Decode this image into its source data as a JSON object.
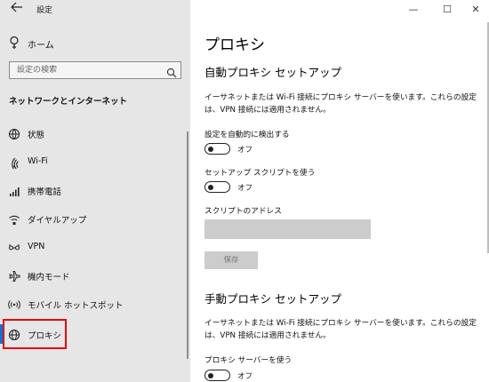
{
  "window": {
    "app_title": "設定",
    "controls": {
      "minimize": "—",
      "maximize": "☐",
      "close": "✕"
    }
  },
  "sidebar": {
    "back_icon": "back-arrow-icon",
    "home": {
      "label": "ホーム",
      "icon": "home-icon"
    },
    "search": {
      "placeholder": "設定の検索",
      "icon": "search-icon"
    },
    "section_heading": "ネットワークとインターネット",
    "items": [
      {
        "label": "状態",
        "icon": "globe-status-icon"
      },
      {
        "label": "Wi-Fi",
        "icon": "wifi-icon"
      },
      {
        "label": "携帯電話",
        "icon": "cellular-icon"
      },
      {
        "label": "ダイヤルアップ",
        "icon": "dialup-icon"
      },
      {
        "label": "VPN",
        "icon": "vpn-icon"
      },
      {
        "label": "機内モード",
        "icon": "airplane-icon"
      },
      {
        "label": "モバイル ホットスポット",
        "icon": "hotspot-icon"
      },
      {
        "label": "プロキシ",
        "icon": "globe-icon",
        "selected": true
      }
    ],
    "accent_color": "#0078d7",
    "highlight_color": "#e8000b"
  },
  "main": {
    "title": "プロキシ",
    "auto": {
      "heading": "自動プロキシ セットアップ",
      "description": "イーサネットまたは Wi-Fi 接続にプロキシ サーバーを使います。これらの設定は、VPN 接続には適用されません。",
      "detect": {
        "label": "設定を自動的に検出する",
        "state": "オフ"
      },
      "script": {
        "label": "セットアップ スクリプトを使う",
        "state": "オフ"
      },
      "address": {
        "label": "スクリプトのアドレス",
        "value": ""
      },
      "save_label": "保存"
    },
    "manual": {
      "heading": "手動プロキシ セットアップ",
      "description": "イーサネットまたは Wi-Fi 接続にプロキシ サーバーを使います。これらの設定は、VPN 接続には適用されません。",
      "use_proxy": {
        "label": "プロキシ サーバーを使う",
        "state": "オフ"
      }
    }
  }
}
